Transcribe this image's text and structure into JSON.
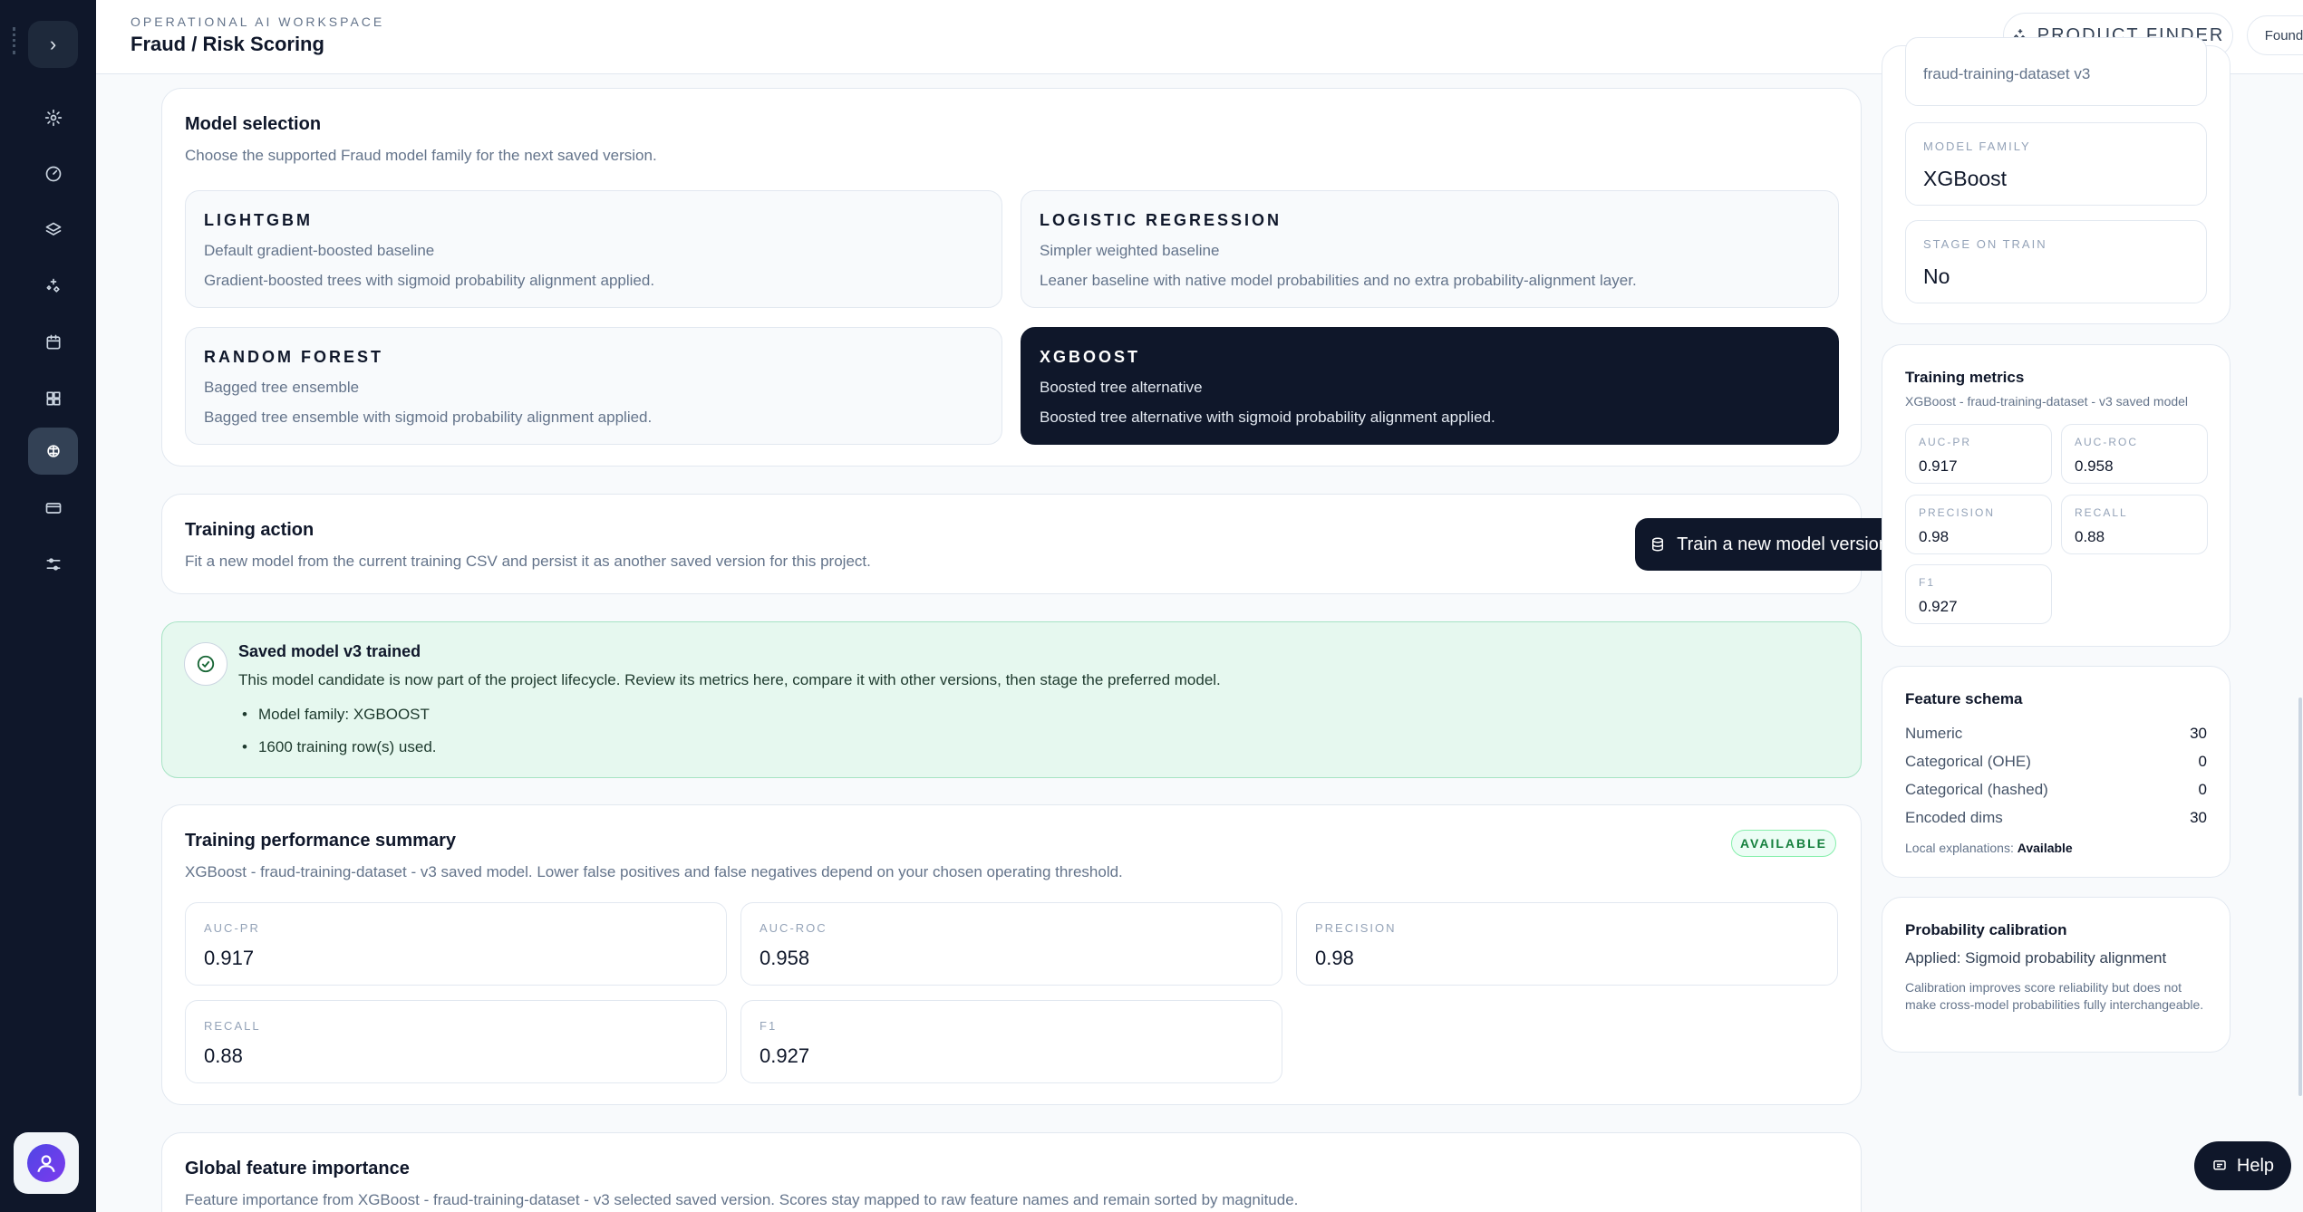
{
  "header": {
    "eyebrow": "OPERATIONAL AI WORKSPACE",
    "title": "Fraud / Risk Scoring",
    "finder_label": "PRODUCT FINDER",
    "account_label": "Founder account"
  },
  "model_selection": {
    "title": "Model selection",
    "subtitle": "Choose the supported Fraud model family for the next saved version.",
    "cards": [
      {
        "name": "LIGHTGBM",
        "tag": "Default gradient-boosted baseline",
        "desc": "Gradient-boosted trees with sigmoid probability alignment applied."
      },
      {
        "name": "LOGISTIC REGRESSION",
        "tag": "Simpler weighted baseline",
        "desc": "Leaner baseline with native model probabilities and no extra probability-alignment layer."
      },
      {
        "name": "RANDOM FOREST",
        "tag": "Bagged tree ensemble",
        "desc": "Bagged tree ensemble with sigmoid probability alignment applied."
      },
      {
        "name": "XGBOOST",
        "tag": "Boosted tree alternative",
        "desc": "Boosted tree alternative with sigmoid probability alignment applied."
      }
    ]
  },
  "training_action": {
    "title": "Training action",
    "subtitle": "Fit a new model from the current training CSV and persist it as another saved version for this project.",
    "button_label": "Train a new model version"
  },
  "success": {
    "title": "Saved model v3 trained",
    "body": "This model candidate is now part of the project lifecycle. Review its metrics here, compare it with other versions, then stage the preferred model.",
    "bullets": [
      "Model family: XGBOOST",
      "1600 training row(s) used."
    ]
  },
  "performance": {
    "title": "Training performance summary",
    "badge": "AVAILABLE",
    "subtitle": "XGBoost - fraud-training-dataset - v3 saved model. Lower false positives and false negatives depend on your chosen operating threshold.",
    "metrics": [
      {
        "label": "AUC-PR",
        "value": "0.917"
      },
      {
        "label": "AUC-ROC",
        "value": "0.958"
      },
      {
        "label": "PRECISION",
        "value": "0.98"
      },
      {
        "label": "RECALL",
        "value": "0.88"
      },
      {
        "label": "F1",
        "value": "0.927"
      }
    ]
  },
  "feature_importance": {
    "title": "Global feature importance",
    "subtitle": "Feature importance from XGBoost - fraud-training-dataset - v3 selected saved version. Scores stay mapped to raw feature names and remain sorted by magnitude."
  },
  "right": {
    "dataset_value": "fraud-training-dataset v3",
    "model_family": {
      "label": "MODEL FAMILY",
      "value": "XGBoost"
    },
    "stage_on_train": {
      "label": "STAGE ON TRAIN",
      "value": "No"
    },
    "training_metrics": {
      "title": "Training metrics",
      "subtitle": "XGBoost - fraud-training-dataset - v3 saved model",
      "items": [
        {
          "label": "AUC-PR",
          "value": "0.917"
        },
        {
          "label": "AUC-ROC",
          "value": "0.958"
        },
        {
          "label": "PRECISION",
          "value": "0.98"
        },
        {
          "label": "RECALL",
          "value": "0.88"
        },
        {
          "label": "F1",
          "value": "0.927"
        }
      ]
    },
    "feature_schema": {
      "title": "Feature schema",
      "rows": [
        {
          "label": "Numeric",
          "value": "30"
        },
        {
          "label": "Categorical (OHE)",
          "value": "0"
        },
        {
          "label": "Categorical (hashed)",
          "value": "0"
        },
        {
          "label": "Encoded dims",
          "value": "30"
        }
      ],
      "local_label": "Local explanations:",
      "local_value": "Available"
    },
    "calibration": {
      "title": "Probability calibration",
      "applied": "Applied: Sigmoid probability alignment",
      "note": "Calibration improves score reliability but does not make cross-model probabilities fully interchangeable."
    }
  },
  "help_label": "Help"
}
